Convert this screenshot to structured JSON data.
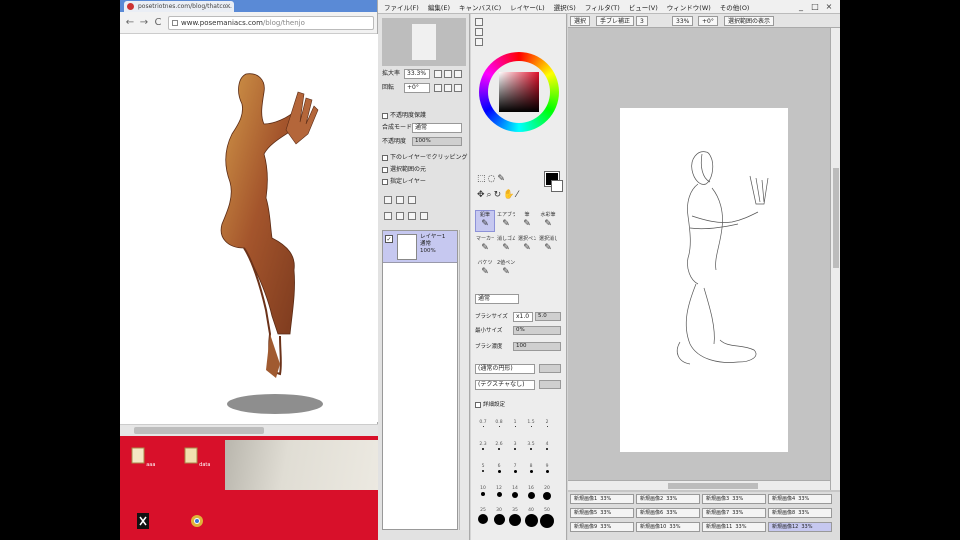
{
  "browser": {
    "tab_title": "posetriotnes.com/blog/thatco...",
    "tab_close": "×",
    "nav_back": "←",
    "nav_forward": "→",
    "nav_reload": "C",
    "url_host": "www.posemaniacs.com",
    "url_path": "/blog/thenjo"
  },
  "desktop": {
    "icons": [
      {
        "label": "aaa",
        "icon": "folder-icon"
      },
      {
        "label": "data",
        "icon": "folder-icon"
      },
      {
        "label": "",
        "icon": "capcut-icon"
      },
      {
        "label": "",
        "icon": "chrome-icon"
      }
    ],
    "colors": {
      "wallpaper": "#d8102a"
    }
  },
  "sai": {
    "menu": [
      "ファイル(F)",
      "編集(E)",
      "キャンバス(C)",
      "レイヤー(L)",
      "選択(S)",
      "フィルタ(T)",
      "ビュー(V)",
      "ウィンドウ(W)",
      "その他(O)"
    ],
    "window_controls": [
      "_",
      "□",
      "×"
    ],
    "navigator": {
      "zoom_label": "拡大率",
      "zoom_value": "33.3%",
      "rotate_label": "回転",
      "rotate_value": "+0°"
    },
    "layer_props": {
      "protect_opacity": "不透明度保護",
      "mode_label": "合成モード",
      "mode_value": "通常",
      "opacity_label": "不透明度",
      "opacity_value": "100%",
      "clip_group": "下のレイヤーでクリッピング",
      "select_source": "選択範囲の元",
      "specify_layer": "指定レイヤー"
    },
    "layers": [
      {
        "name": "レイヤー1",
        "mode": "通常",
        "opacity": "100%"
      }
    ],
    "color_colors": {
      "foreground": "#000000",
      "background": "#ffffff",
      "hue": "#e0102a"
    },
    "tools": [
      {
        "label": "鉛筆",
        "icon": "pencil-icon",
        "active": true
      },
      {
        "label": "エアブラシ",
        "icon": "airbrush-icon",
        "active": false
      },
      {
        "label": "筆",
        "icon": "brush-icon",
        "active": false
      },
      {
        "label": "水彩筆",
        "icon": "watercolor-icon",
        "active": false
      },
      {
        "label": "マーカー",
        "icon": "marker-icon",
        "active": false
      },
      {
        "label": "消しゴム",
        "icon": "eraser-icon",
        "active": false
      },
      {
        "label": "選択ペン",
        "icon": "select-pen-icon",
        "active": false
      },
      {
        "label": "選択消し",
        "icon": "select-erase-icon",
        "active": false
      },
      {
        "label": "バケツ",
        "icon": "bucket-icon",
        "active": false
      },
      {
        "label": "2値ペン",
        "icon": "binary-pen-icon",
        "active": false
      }
    ],
    "tool_settings": {
      "blend_value": "通常",
      "size_label": "ブラシサイズ",
      "size_multiplier": "x1.0",
      "size_value": "5.0",
      "min_size_label": "最小サイズ",
      "min_size_value": "0%",
      "density_label": "ブラシ濃度",
      "density_value": "100",
      "shape_value": "(通常の円形)",
      "texture_value": "(テクスチャなし)",
      "detail_label": "詳細設定"
    },
    "brush_presets": [
      {
        "label": "0.7",
        "size": 1
      },
      {
        "label": "0.8",
        "size": 1
      },
      {
        "label": "1",
        "size": 1
      },
      {
        "label": "1.5",
        "size": 1
      },
      {
        "label": "2",
        "size": 1
      },
      {
        "label": "2.3",
        "size": 2
      },
      {
        "label": "2.6",
        "size": 2
      },
      {
        "label": "3",
        "size": 2
      },
      {
        "label": "3.5",
        "size": 2
      },
      {
        "label": "4",
        "size": 2
      },
      {
        "label": "5",
        "size": 2
      },
      {
        "label": "6",
        "size": 3
      },
      {
        "label": "7",
        "size": 3
      },
      {
        "label": "8",
        "size": 3
      },
      {
        "label": "9",
        "size": 3
      },
      {
        "label": "10",
        "size": 4
      },
      {
        "label": "12",
        "size": 5
      },
      {
        "label": "14",
        "size": 6
      },
      {
        "label": "16",
        "size": 7
      },
      {
        "label": "20",
        "size": 8
      },
      {
        "label": "25",
        "size": 10
      },
      {
        "label": "30",
        "size": 11
      },
      {
        "label": "35",
        "size": 12
      },
      {
        "label": "40",
        "size": 13
      },
      {
        "label": "50",
        "size": 14
      }
    ],
    "canvas_toolbar": {
      "select_label": "選択",
      "stabilizer_label": "手ブレ補正",
      "stabilizer_value": "3",
      "zoom_value": "33%",
      "angle_value": "+0°",
      "antialias_label": "選択範囲の表示"
    },
    "documents": [
      {
        "name": "新規画像1",
        "zoom": "33%"
      },
      {
        "name": "新規画像2",
        "zoom": "33%"
      },
      {
        "name": "新規画像3",
        "zoom": "33%"
      },
      {
        "name": "新規画像4",
        "zoom": "33%"
      },
      {
        "name": "新規画像5",
        "zoom": "33%"
      },
      {
        "name": "新規画像6",
        "zoom": "33%"
      },
      {
        "name": "新規画像7",
        "zoom": "33%"
      },
      {
        "name": "新規画像8",
        "zoom": "33%"
      },
      {
        "name": "新規画像9",
        "zoom": "33%"
      },
      {
        "name": "新規画像10",
        "zoom": "33%"
      },
      {
        "name": "新規画像11",
        "zoom": "33%"
      },
      {
        "name": "新規画像12",
        "zoom": "33%",
        "current": true
      }
    ]
  }
}
